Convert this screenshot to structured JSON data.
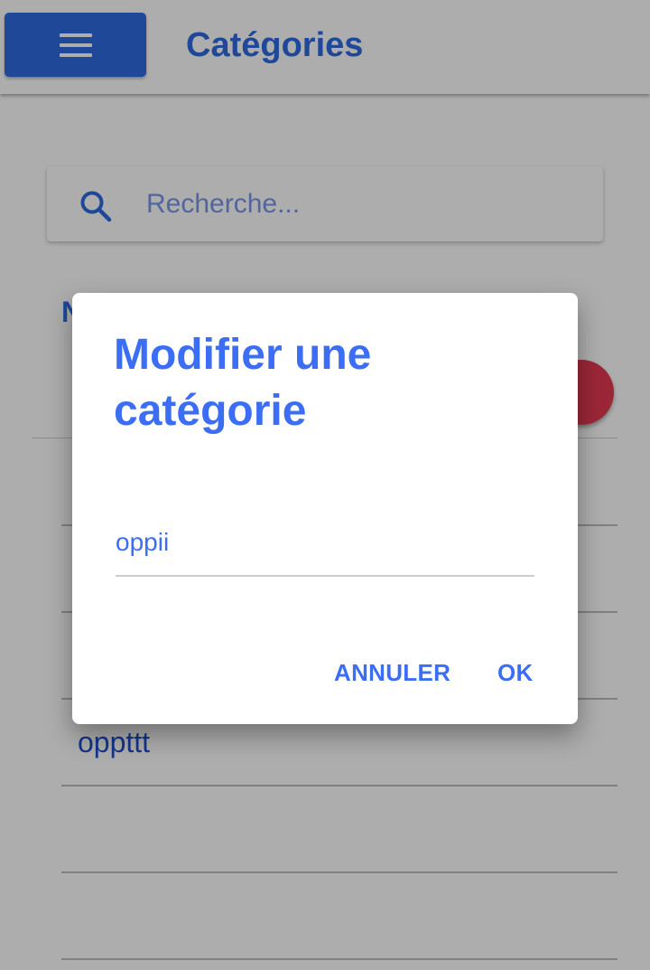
{
  "colors": {
    "primary": "#2f6be0",
    "accent_text": "#3b6ef5",
    "danger": "#e53950",
    "placeholder": "#7a96e8",
    "list_text": "#1e4fcf"
  },
  "app_bar": {
    "menu_icon": "hamburger-icon",
    "title": "Catégories"
  },
  "search": {
    "icon": "search-icon",
    "placeholder": "Recherche...",
    "value": ""
  },
  "list": {
    "column_header": "N",
    "add_button_icon": "add-icon",
    "rows": [
      {
        "name": ""
      },
      {
        "name": ""
      },
      {
        "name": ""
      },
      {
        "name": "oppttt"
      },
      {
        "name": ""
      },
      {
        "name": ""
      }
    ]
  },
  "dialog": {
    "title": "Modifier une catégorie",
    "input_value": "oppii",
    "cancel_label": "ANNULER",
    "ok_label": "OK"
  }
}
